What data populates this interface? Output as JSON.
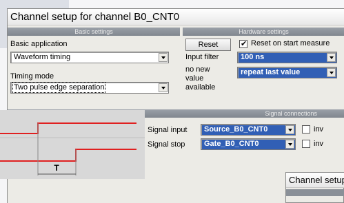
{
  "window": {
    "title": "Channel setup for channel B0_CNT0"
  },
  "sections": {
    "basic": "Basic settings",
    "hardware": "Hardware settings",
    "signals": "Signal connections"
  },
  "basic": {
    "application_label": "Basic application",
    "application_value": "Waveform timing",
    "timing_label": "Timing mode",
    "timing_value": "Two pulse edge separation"
  },
  "hardware": {
    "reset_label": "Reset",
    "reset_on_start_label": "Reset on start measure",
    "reset_on_start_checked": true,
    "input_filter_label": "Input filter",
    "input_filter_value": "100 ns",
    "no_new_value_label": [
      "no new",
      "value",
      "available"
    ],
    "no_new_value_value": "repeat last value"
  },
  "signals": {
    "input_label": "Signal input",
    "input_value": "Source_B0_CNT0",
    "input_inv_label": "inv",
    "input_inv_checked": false,
    "stop_label": "Signal stop",
    "stop_value": "Gate_B0_CNT0",
    "stop_inv_label": "inv",
    "stop_inv_checked": false,
    "diagram_label": "T"
  },
  "background_window": {
    "title": "Channel setup"
  },
  "colors": {
    "signal_line": "#e02020",
    "selected_bg": "#315fb5",
    "section_header": "#8a9098"
  }
}
